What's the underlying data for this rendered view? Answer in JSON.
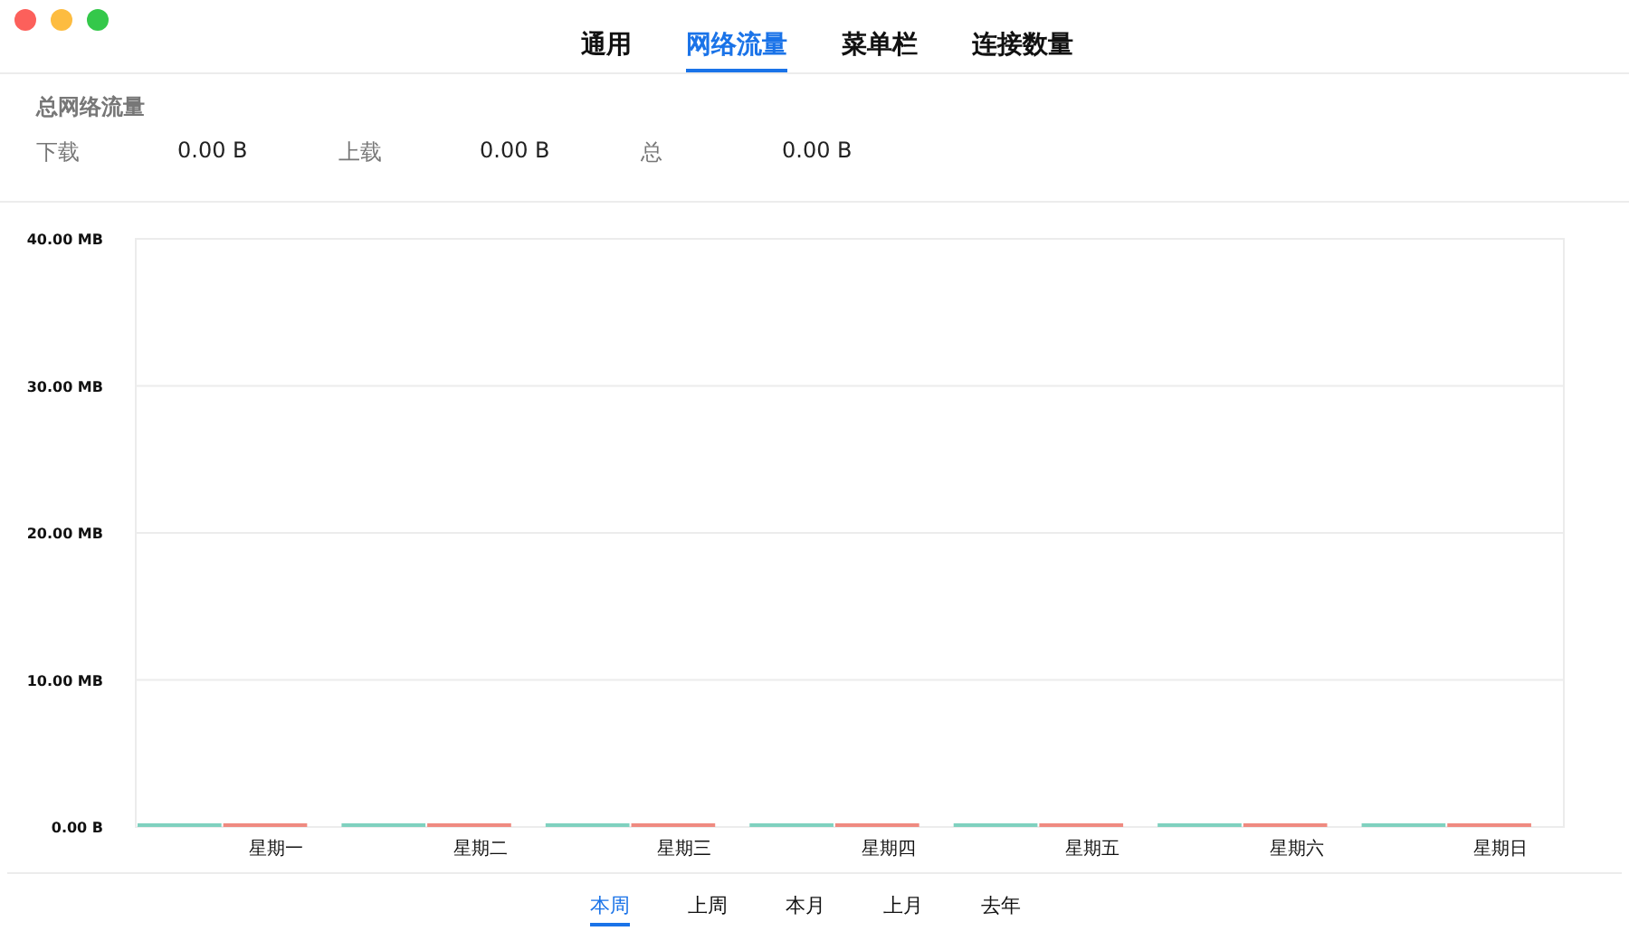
{
  "window": {
    "controls": [
      {
        "kind": "close"
      },
      {
        "kind": "minimize"
      },
      {
        "kind": "zoom"
      }
    ]
  },
  "tabs": [
    {
      "label": "通用",
      "selected": false
    },
    {
      "label": "网络流量",
      "selected": true
    },
    {
      "label": "菜单栏",
      "selected": false
    },
    {
      "label": "连接数量",
      "selected": false
    }
  ],
  "summary": {
    "title": "总网络流量",
    "items": [
      {
        "label": "下载",
        "value": "0.00 B"
      },
      {
        "label": "上载",
        "value": "0.00 B"
      },
      {
        "label": "总",
        "value": "0.00 B"
      }
    ]
  },
  "chart": {
    "chart_data": {
      "type": "bar",
      "categories": [
        "星期一",
        "星期二",
        "星期三",
        "星期四",
        "星期五",
        "星期六",
        "星期日"
      ],
      "series": [
        {
          "color": "#7fd1bf",
          "values": [
            0,
            0,
            0,
            0,
            0,
            0,
            0
          ]
        },
        {
          "color": "#ef8a80",
          "values": [
            0,
            0,
            0,
            0,
            0,
            0,
            0
          ]
        }
      ],
      "ylim": [
        0,
        40
      ],
      "grid": true,
      "yticks": [
        {
          "value": 0,
          "label": "0.00 B"
        },
        {
          "value": 10,
          "label": "10.00 MB"
        },
        {
          "value": 20,
          "label": "20.00 MB"
        },
        {
          "value": 30,
          "label": "30.00 MB"
        },
        {
          "value": 40,
          "label": "40.00 MB"
        }
      ]
    }
  },
  "periods": [
    {
      "label": "本周",
      "selected": true
    },
    {
      "label": "上周",
      "selected": false
    },
    {
      "label": "本月",
      "selected": false
    },
    {
      "label": "上月",
      "selected": false
    },
    {
      "label": "去年",
      "selected": false
    }
  ]
}
